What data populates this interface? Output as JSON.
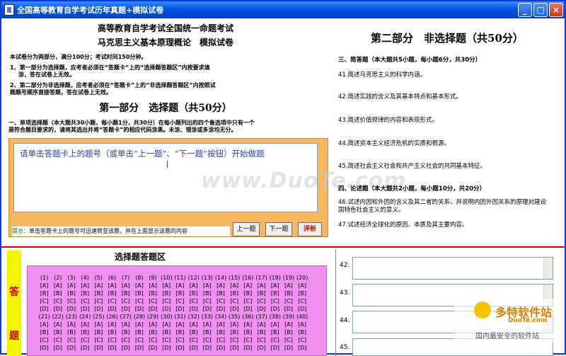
{
  "window": {
    "title": "全国高等教育自学考试历年真题+模拟试卷",
    "min": "_",
    "max": "□",
    "close": "×"
  },
  "header": {
    "line1": "高等教育自学考试全国统一命题考试",
    "line2": "马克思主义基本原理概论　模拟试卷",
    "intro": "本试卷分为两部分，满分100分；考试时间150分钟。",
    "note1a": "1、第一部分为选择题，应考者必须在“答题卡”上的“选择题答题区”内按要求填",
    "note1b": "涂，答在试卷上无效。",
    "note2a": "2、第二部分为非选择题，应考者必须在“答题卡”上的“非选择题答题区”内按照试",
    "note2b": "题题号顺序直接答题，答在试卷上无效。"
  },
  "part1": {
    "title": "第一部分　选择题（共50分）",
    "desc1": "一、单项选择题（本大题共30小题，每小题1分，共30分）在每小题列出的四个备选项中只有一个",
    "desc2": "是符合题目要求的，请将其选出并将“答题卡”的相应代码涂黑。未涂、错涂或多涂均无分。"
  },
  "question_panel": {
    "text": "请单击答题卡上的题号（或单击“上一题”、“下一题”按钮）开始做题",
    "hint_label": "提示：",
    "hint": "单击答题卡上的题号可迅速转至该题，并在上面显示该题的内容",
    "prev": "上一题",
    "next": "下一题",
    "review": "评析"
  },
  "part2": {
    "title": "第二部分　非选择题（共50分）",
    "sec3": "三、简答题（本大题共5小题，每小题6分，共30分）",
    "q41": "41.简述马克思主义的科学内涵。",
    "q42": "42.简述实践的含义及其基本特点和基本形式。",
    "q43": "43.简述价值规律的内容和表现形式。",
    "q44": "44.简述资本主义经济危机的实质和根源。",
    "q45": "45.简述社会主义社会和共产主义社会的共同基本特征。",
    "sec4": "四、论述题（本大题共2小题，每小题10分，共20分）",
    "q46a": "46.试述内因和外因的含义及其二者的关系，并说明内因外因关系的原理对建设",
    "q46b": "国特色社会主义的意义。",
    "q47": "47.试述经济全球化的原因、本质及其主要内容。"
  },
  "answer_card": {
    "side1": "答",
    "side2": "题",
    "title": "选择题答题区",
    "nums1": [
      "(1)",
      "(2)",
      "(3)",
      "(4)",
      "(5)",
      "(6)",
      "(7)",
      "(8)",
      "(9)",
      "(10)",
      "(11)",
      "(12)",
      "(13)",
      "(14)",
      "(15)",
      "(16)",
      "(17)",
      "(18)",
      "(19)",
      "(20)"
    ],
    "nums2": [
      "(21)",
      "(22)",
      "(23)",
      "(24)",
      "(25)",
      "(26)",
      "(27)",
      "(28)",
      "(29)",
      "(30)",
      "(31)",
      "(32)",
      "(33)",
      "(34)",
      "(35)",
      "(36)",
      "(37)",
      "(38)",
      "(39)",
      "(40)"
    ],
    "opts": [
      "[A]",
      "[B]",
      "[C]",
      "[D]"
    ],
    "labels": [
      "42.",
      "43.",
      "44.",
      "45."
    ]
  },
  "watermark": "www.DuoTe.com",
  "logo": {
    "text": "多特软件站",
    "site": "DuoTe.com",
    "slogan": "国内最安全的软件站"
  }
}
